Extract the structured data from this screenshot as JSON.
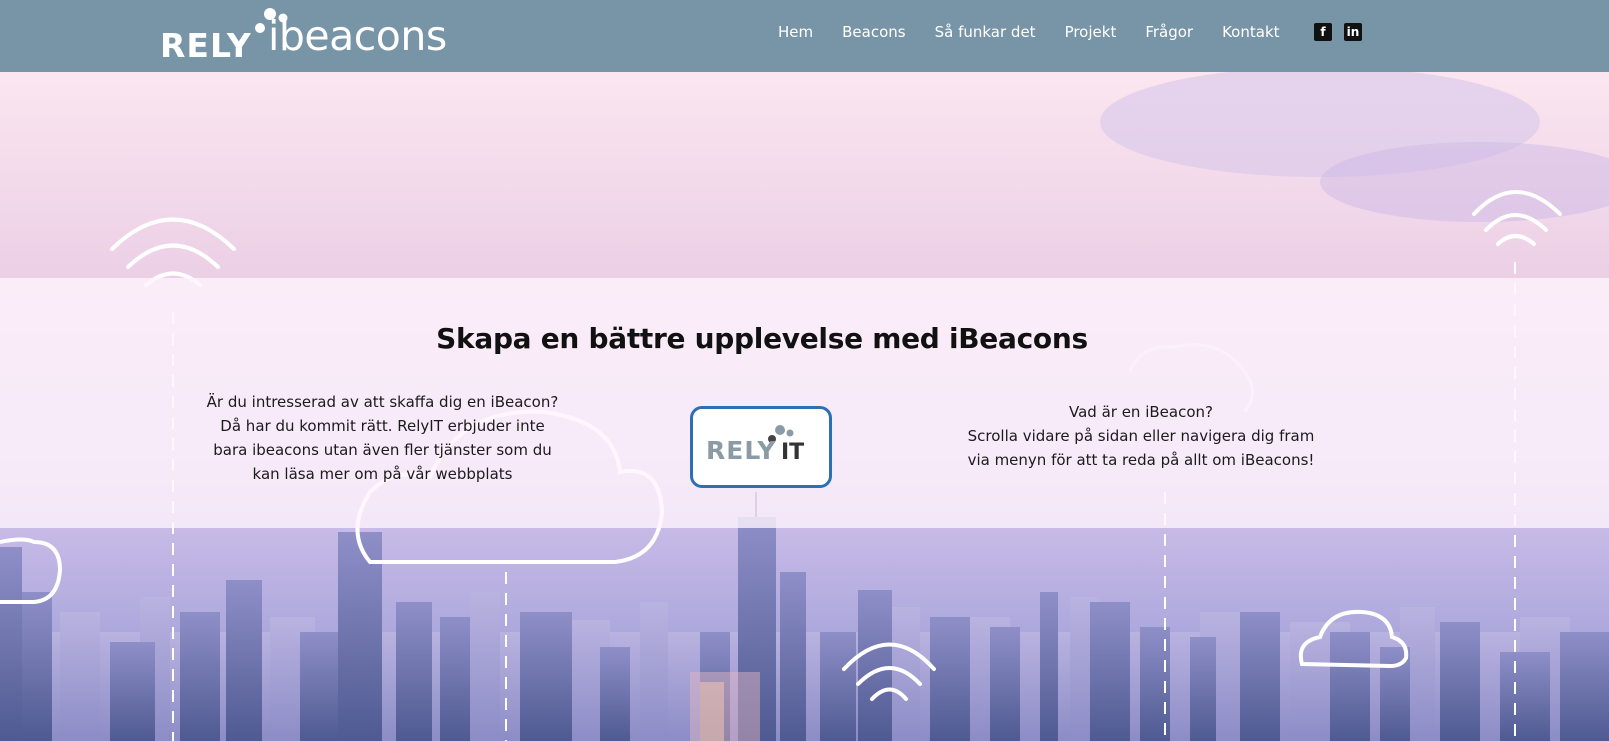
{
  "header": {
    "logo_rely": "RELY",
    "logo_ibeacons": "ibeacons",
    "nav": [
      "Hem",
      "Beacons",
      "Så funkar det",
      "Projekt",
      "Frågor",
      "Kontakt"
    ],
    "social": [
      {
        "name": "facebook-icon",
        "glyph": "f"
      },
      {
        "name": "linkedin-icon",
        "glyph": "in"
      }
    ]
  },
  "hero": {
    "headline": "Skapa en bättre upplevelse med iBeacons",
    "left_text": [
      "Är du intresserad av att skaffa dig en iBeacon?",
      "Då har du kommit rätt. RelyIT erbjuder inte",
      "bara ibeacons utan även fler tjänster som du",
      "kan läsa mer om på vår webbplats"
    ],
    "right_text": [
      "Vad är en iBeacon?",
      "Scrolla vidare på sidan eller navigera dig fram",
      "via menyn för att ta reda på allt om iBeacons!"
    ],
    "center_logo": {
      "rely": "RELY",
      "it": "IT"
    }
  },
  "colors": {
    "header_bg": "#7895a7",
    "logo_border": "#2d6fb5",
    "text": "#1b1b1b"
  }
}
